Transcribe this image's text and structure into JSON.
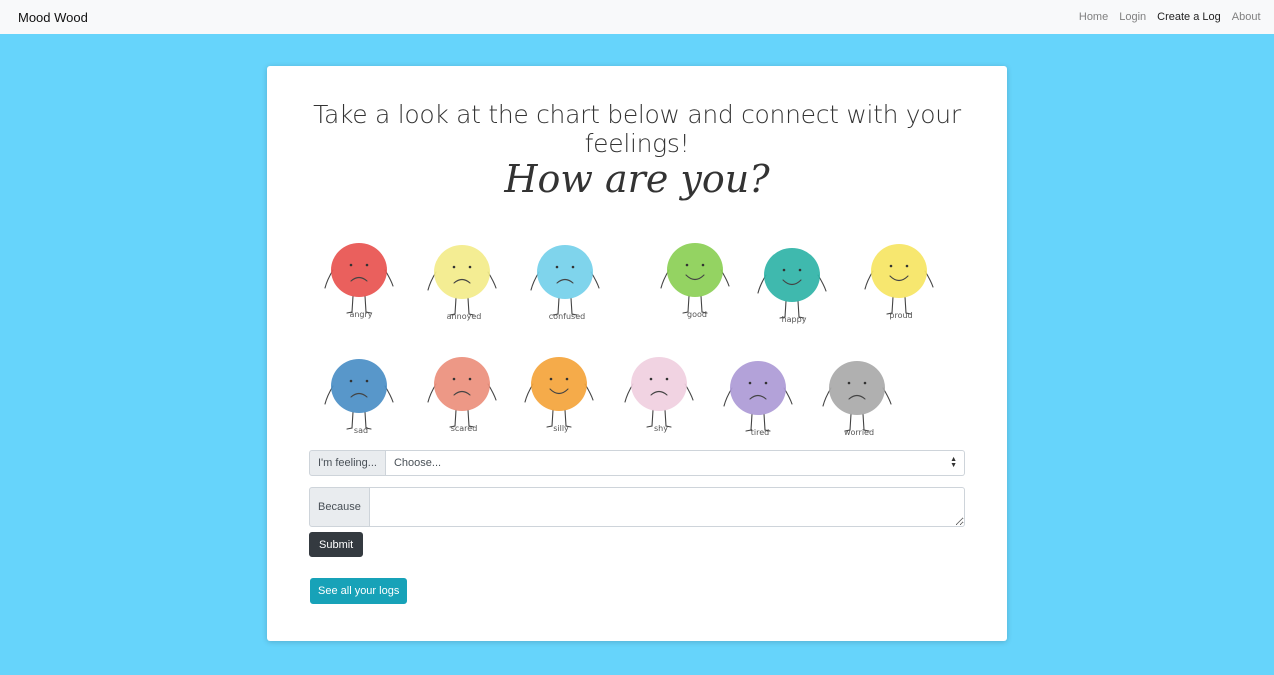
{
  "navbar": {
    "brand": "Mood Wood",
    "links": [
      {
        "label": "Home",
        "active": false
      },
      {
        "label": "Login",
        "active": false
      },
      {
        "label": "Create a Log",
        "active": true
      },
      {
        "label": "About",
        "active": false
      }
    ]
  },
  "main": {
    "headline": "Take a look at the chart below and connect with your feelings!",
    "chart_image": {
      "title": "How are you?",
      "moods": [
        {
          "label": "angry",
          "color": "#e8534f"
        },
        {
          "label": "annoyed",
          "color": "#f3eb8a"
        },
        {
          "label": "confused",
          "color": "#74d0ea"
        },
        {
          "label": "good",
          "color": "#8bcf55"
        },
        {
          "label": "happy",
          "color": "#2fb3a7"
        },
        {
          "label": "proud",
          "color": "#f6e563"
        },
        {
          "label": "sad",
          "color": "#4a8ec6"
        },
        {
          "label": "scared",
          "color": "#ec8f7c"
        },
        {
          "label": "silly",
          "color": "#f4a43b"
        },
        {
          "label": "shy",
          "color": "#f0cfe0"
        },
        {
          "label": "tired",
          "color": "#ad9ad6"
        },
        {
          "label": "worried",
          "color": "#a9a9a9"
        }
      ]
    },
    "form": {
      "feeling_label": "I'm feeling...",
      "feeling_selected": "Choose...",
      "because_label": "Because",
      "because_value": "",
      "submit_label": "Submit"
    },
    "see_logs_label": "See all your logs"
  },
  "colors": {
    "page_background": "#66d4fb",
    "submit_button": "#343a40",
    "logs_button": "#17a2b8"
  }
}
